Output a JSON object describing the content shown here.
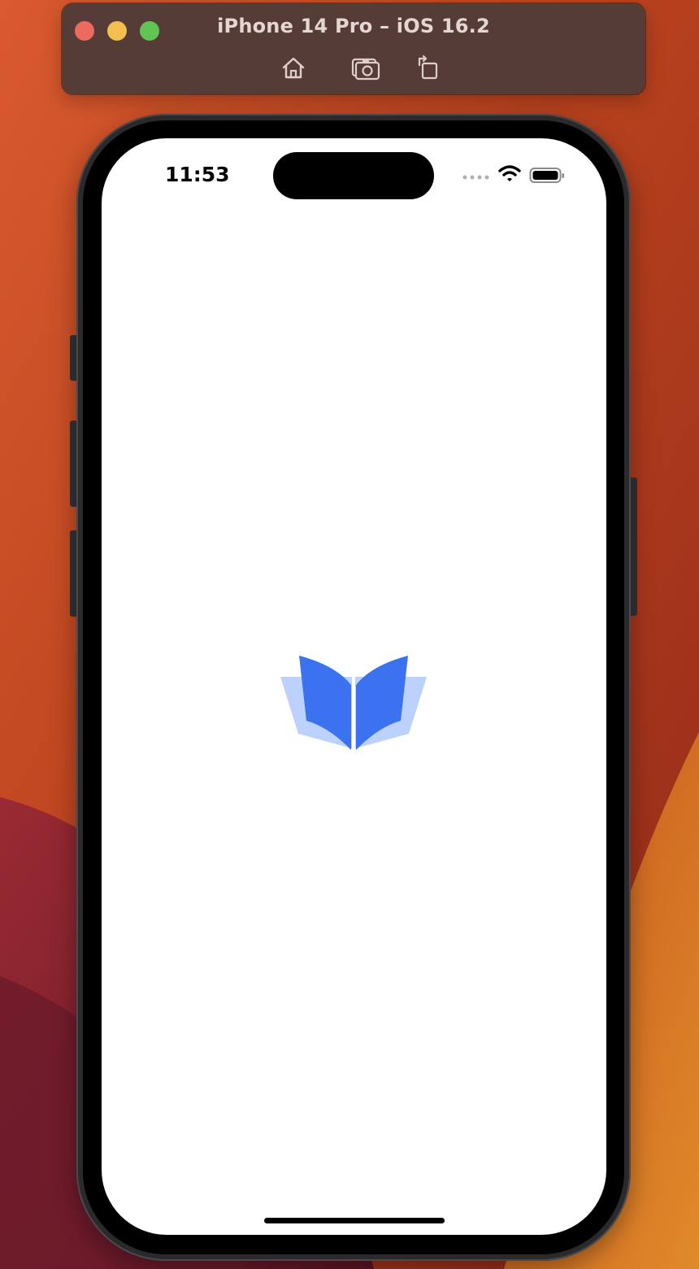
{
  "window": {
    "title": "iPhone 14 Pro – iOS 16.2",
    "controls": {
      "close": "close-icon",
      "minimize": "minimize-icon",
      "zoom": "zoom-icon"
    },
    "toolbar": {
      "home_icon": "home-icon",
      "screenshot_icon": "camera-icon",
      "rotate_icon": "rotate-icon"
    }
  },
  "status_bar": {
    "time": "11:53",
    "signal_icon": "cellular-signal-icon",
    "wifi_icon": "wifi-icon",
    "battery_icon": "battery-icon"
  },
  "screen": {
    "background": "#ffffff",
    "logo_icon": "open-book-icon",
    "logo_colors": {
      "primary": "#3a72f0",
      "secondary": "#bcd1fb"
    }
  },
  "colors": {
    "titlebar": "#563c36",
    "close": "#ed6a5e",
    "minimize": "#f4bf4f",
    "zoom": "#61c554"
  }
}
